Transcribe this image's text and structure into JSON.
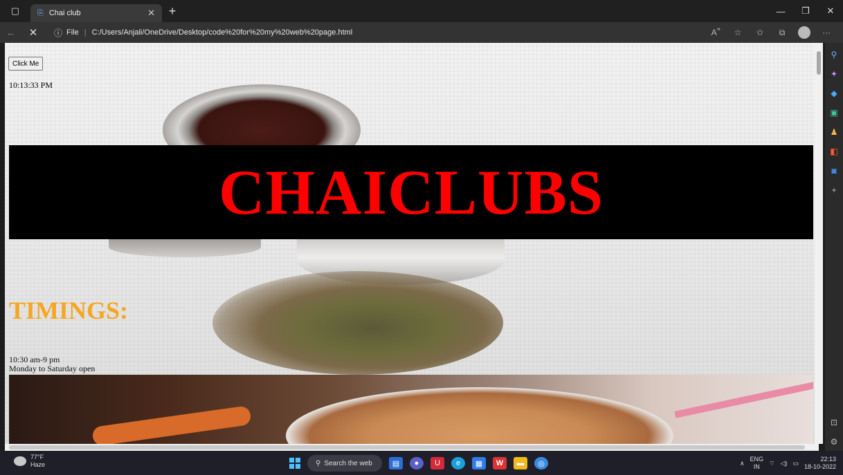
{
  "browser": {
    "tab_title": "Chai club",
    "url_prefix": "File",
    "url": "C:/Users/Anjali/OneDrive/Desktop/code%20for%20my%20web%20page.html"
  },
  "page": {
    "button_label": "Click Me",
    "clock_text": "10:13:33 PM",
    "banner_title": "CHAICLUBS",
    "timings_heading": "TIMINGS:",
    "hours_line1": "10:30 am-9 pm",
    "hours_line2": "Monday to Saturday open",
    "colors": {
      "banner_bg": "#000000",
      "banner_text": "#ff0000",
      "timings_text": "#f5a623"
    }
  },
  "taskbar": {
    "weather_temp": "77°F",
    "weather_desc": "Haze",
    "search_placeholder": "Search the web",
    "lang_line1": "ENG",
    "lang_line2": "IN",
    "time": "22:13",
    "date": "18-10-2022"
  },
  "icons": {
    "sidebar": [
      "search-icon",
      "sparkle-icon",
      "tag-icon",
      "shopping-icon",
      "games-icon",
      "office-icon",
      "outlook-icon",
      "add-icon"
    ],
    "sidebar_bottom": [
      "screen-icon",
      "settings-icon"
    ]
  }
}
